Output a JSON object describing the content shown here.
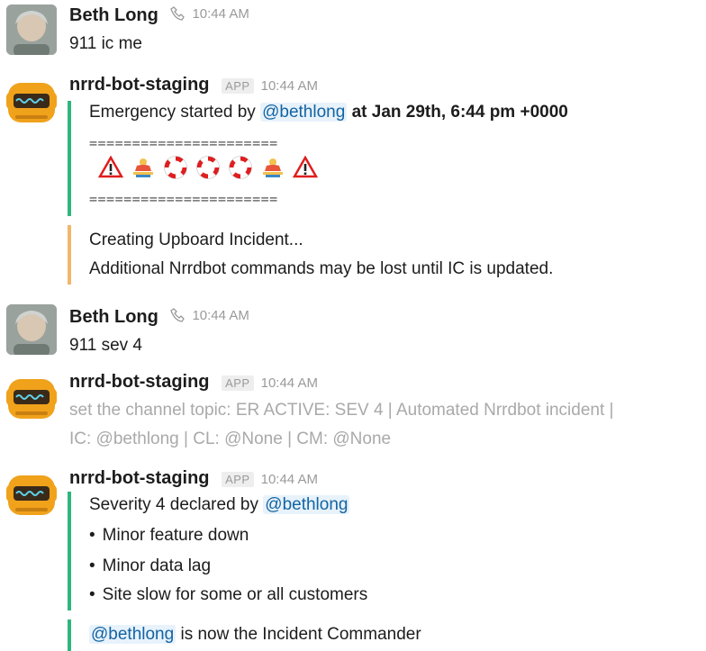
{
  "messages": [
    {
      "author": "Beth Long",
      "time": "10:44 AM",
      "text": "911 ic me"
    },
    {
      "author": "nrrd-bot-staging",
      "badge": "APP",
      "time": "10:44 AM",
      "attachment1": {
        "prefix": "Emergency started by",
        "mention": "@bethlong",
        "suffix": "at Jan 29th, 6:44 pm +0000",
        "rule": "======================",
        "emojis": [
          "warning-icon",
          "lifeguard-icon",
          "lifebuoy-icon",
          "lifebuoy-icon",
          "lifebuoy-icon",
          "lifeguard-icon",
          "warning-icon"
        ]
      },
      "attachment2": {
        "title": "Creating Upboard Incident...",
        "text": "Additional Nrrdbot commands may be lost until IC is updated."
      }
    },
    {
      "author": "Beth Long",
      "time": "10:44 AM",
      "text": "911 sev 4"
    },
    {
      "author": "nrrd-bot-staging",
      "badge": "APP",
      "time": "10:44 AM",
      "line1": "set the channel topic: ER ACTIVE: SEV 4 | Automated Nrrdbot incident |",
      "line2": "IC: @bethlong | CL: @None | CM: @None"
    },
    {
      "author": "nrrd-bot-staging",
      "badge": "APP",
      "time": "10:44 AM",
      "attachment1": {
        "prefix": "Severity 4 declared by",
        "mention": "@bethlong",
        "bullets": [
          "Minor feature down",
          "Minor data lag",
          "Site slow for some or all customers"
        ]
      },
      "attachment2": {
        "mention": "@bethlong",
        "suffix": "is now the Incident Commander"
      }
    }
  ],
  "colors": {
    "green_bar": "#2eb67d",
    "orange_bar": "#f2b66b",
    "mention": "#1264a3"
  }
}
